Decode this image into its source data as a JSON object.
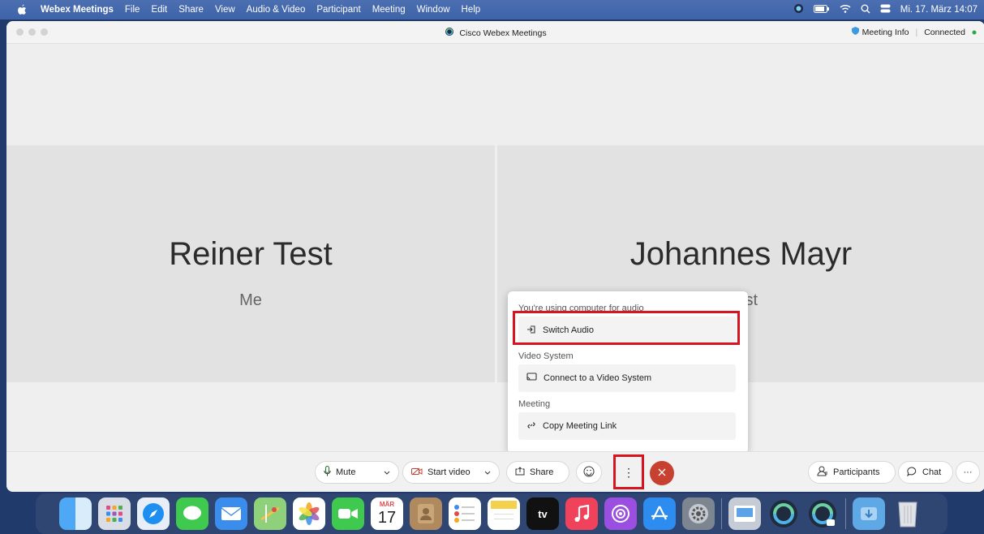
{
  "menubar": {
    "app_name": "Webex Meetings",
    "items": [
      "File",
      "Edit",
      "Share",
      "View",
      "Audio & Video",
      "Participant",
      "Meeting",
      "Window",
      "Help"
    ],
    "datetime": "Mi. 17. März 14:07"
  },
  "window": {
    "title": "Cisco Webex Meetings",
    "meeting_info": "Meeting Info",
    "status": "Connected"
  },
  "participants": [
    {
      "name": "Reiner Test",
      "role": "Me"
    },
    {
      "name": "Johannes Mayr",
      "role": "Host"
    }
  ],
  "menu": {
    "audio_header": "You're using computer for audio",
    "switch_audio": "Switch Audio",
    "video_header": "Video System",
    "connect_video": "Connect to a Video System",
    "meeting_header": "Meeting",
    "copy_link": "Copy Meeting Link"
  },
  "toolbar": {
    "mute": "Mute",
    "start_video": "Start video",
    "share": "Share",
    "participants": "Participants",
    "chat": "Chat",
    "more": "⋮",
    "overflow": "···"
  },
  "dock": {
    "calendar_month": "MÄR",
    "calendar_day": "17",
    "tv_label": "tv"
  },
  "colors": {
    "end_call": "#c8402f",
    "highlight": "#d7141f",
    "connected": "#2ea84a"
  }
}
